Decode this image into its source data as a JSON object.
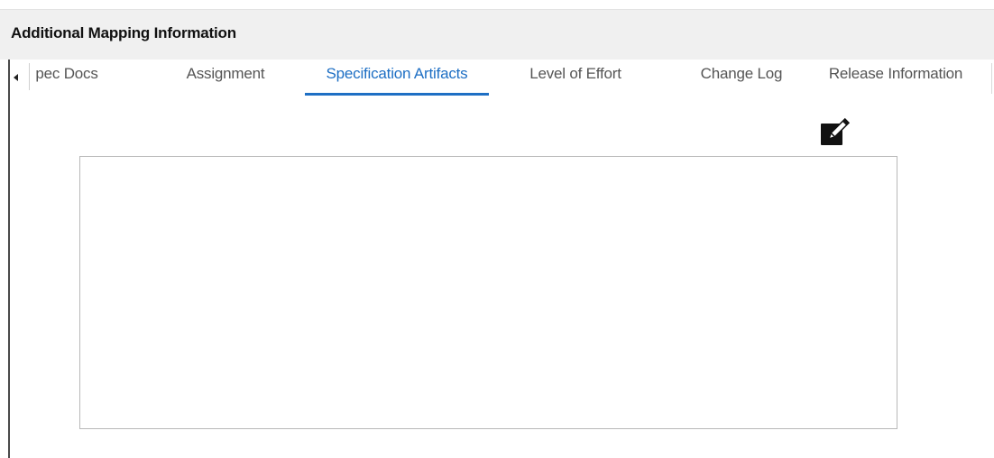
{
  "panel": {
    "title": "Additional Mapping Information"
  },
  "tabs": [
    {
      "label": "pec Docs",
      "active": false
    },
    {
      "label": "Assignment",
      "active": false
    },
    {
      "label": "Specification Artifacts",
      "active": true
    },
    {
      "label": "Level of Effort",
      "active": false
    },
    {
      "label": "Change Log",
      "active": false
    },
    {
      "label": "Release Information",
      "active": false
    }
  ],
  "icons": {
    "tab_scroll_left": "caret-left-icon",
    "edit": "edit-pencil-icon"
  },
  "colors": {
    "active_tab": "#1e6fc4",
    "header_background": "#f0f0f0",
    "inactive_tab_text": "#555555"
  }
}
